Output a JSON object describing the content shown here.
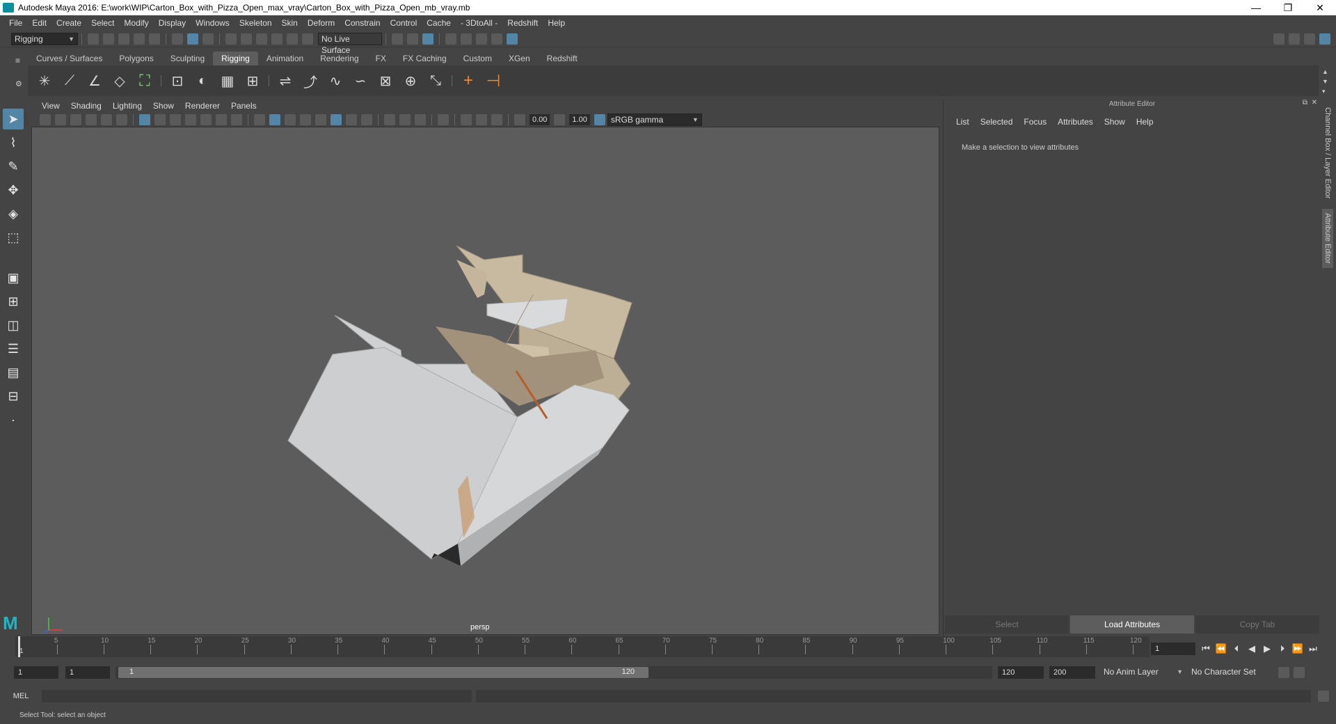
{
  "window": {
    "title": "Autodesk Maya 2016: E:\\work\\WIP\\Carton_Box_with_Pizza_Open_max_vray\\Carton_Box_with_Pizza_Open_mb_vray.mb",
    "min": "—",
    "max": "❐",
    "close": "✕"
  },
  "menubar": [
    "File",
    "Edit",
    "Create",
    "Select",
    "Modify",
    "Display",
    "Windows",
    "Skeleton",
    "Skin",
    "Deform",
    "Constrain",
    "Control",
    "Cache",
    "- 3DtoAll -",
    "Redshift",
    "Help"
  ],
  "statusline": {
    "menuset": "Rigging",
    "live_surface": "No Live Surface"
  },
  "shelf": {
    "tabs": [
      "Curves / Surfaces",
      "Polygons",
      "Sculpting",
      "Rigging",
      "Animation",
      "Rendering",
      "FX",
      "FX Caching",
      "Custom",
      "XGen",
      "Redshift"
    ],
    "active": "Rigging"
  },
  "panel": {
    "menus": [
      "View",
      "Shading",
      "Lighting",
      "Show",
      "Renderer",
      "Panels"
    ],
    "exposure": "0.00",
    "gamma": "1.00",
    "colorspace": "sRGB gamma",
    "camera": "persp"
  },
  "attribute_editor": {
    "title": "Attribute Editor",
    "menus": [
      "List",
      "Selected",
      "Focus",
      "Attributes",
      "Show",
      "Help"
    ],
    "message": "Make a selection to view attributes",
    "buttons": [
      "Select",
      "Load Attributes",
      "Copy Tab"
    ]
  },
  "side_tabs": [
    "Channel Box / Layer Editor",
    "Attribute Editor"
  ],
  "timeline": {
    "ticks": [
      "5",
      "10",
      "15",
      "20",
      "25",
      "30",
      "35",
      "40",
      "45",
      "50",
      "55",
      "60",
      "65",
      "70",
      "75",
      "80",
      "85",
      "90",
      "95",
      "100",
      "105",
      "110",
      "115",
      "120"
    ],
    "current_marker": "1",
    "current_frame": "1"
  },
  "range": {
    "start": "1",
    "playback_start": "1",
    "slider_start": "1",
    "slider_end": "120",
    "playback_end": "120",
    "end": "200",
    "anim_layer": "No Anim Layer",
    "character_set": "No Character Set"
  },
  "mel": {
    "label": "MEL"
  },
  "help_line": "Select Tool: select an object",
  "colors": {
    "accent": "#5285a6",
    "viewport_bg": "#5c5c5c",
    "ui_bg": "#444444"
  }
}
